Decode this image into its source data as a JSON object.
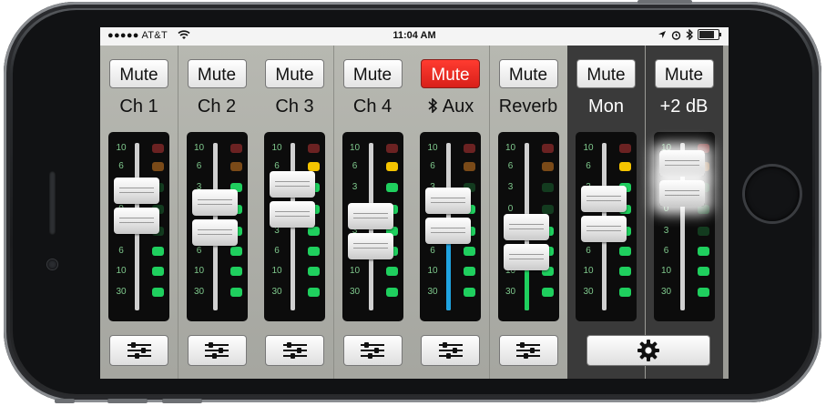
{
  "status_bar": {
    "carrier": "●●●●● AT&T",
    "time": "11:04 AM",
    "icons": [
      "signal-dots-icon",
      "wifi-icon",
      "location-arrow-icon",
      "alarm-clock-icon",
      "bluetooth-icon",
      "battery-icon"
    ]
  },
  "channels": [
    {
      "name": "Ch 1",
      "mute_label": "Mute",
      "muted": false,
      "fader_level": 0.62,
      "meter": [
        false,
        false,
        false,
        false,
        false,
        true,
        true,
        true
      ]
    },
    {
      "name": "Ch 2",
      "mute_label": "Mute",
      "muted": false,
      "fader_level": 0.55,
      "meter": [
        false,
        false,
        true,
        true,
        true,
        true,
        true,
        true
      ]
    },
    {
      "name": "Ch 3",
      "mute_label": "Mute",
      "muted": false,
      "fader_level": 0.66,
      "meter": [
        false,
        true,
        true,
        true,
        true,
        true,
        true,
        true
      ]
    },
    {
      "name": "Ch 4",
      "mute_label": "Mute",
      "muted": false,
      "fader_level": 0.47,
      "meter": [
        false,
        true,
        true,
        true,
        true,
        true,
        true,
        true
      ]
    },
    {
      "name": "Aux",
      "name_icon": "bluetooth-icon",
      "mute_label": "Mute",
      "muted": true,
      "fader_level": 0.56,
      "meter": [
        false,
        false,
        false,
        true,
        true,
        true,
        true,
        true
      ]
    },
    {
      "name": "Reverb",
      "mute_label": "Mute",
      "muted": false,
      "fader_level": 0.4,
      "meter": [
        false,
        false,
        false,
        false,
        true,
        true,
        true,
        true
      ]
    },
    {
      "name": "Mon",
      "mute_label": "Mute",
      "muted": false,
      "fader_level": 0.57,
      "meter": [
        false,
        true,
        true,
        true,
        true,
        true,
        true,
        true
      ]
    },
    {
      "name": "+2 dB",
      "mute_label": "Mute",
      "muted": false,
      "fader_level": 0.78,
      "meter": [
        false,
        false,
        false,
        false,
        false,
        true,
        true,
        true
      ]
    }
  ],
  "fader_scale": [
    "10",
    "6",
    "3",
    "0",
    "3",
    "6",
    "10",
    "30"
  ],
  "colors": {
    "led_green": "#1fcf5e",
    "led_yellow": "#f5c400",
    "led_red_off": "#6b2222",
    "led_orange_off": "#7a4a18",
    "aux_fill": "#1fa3e0",
    "reverb_fill": "#1fcf5e",
    "mute_active": "#e0241c"
  },
  "footer": {
    "eq_button_icon": "sliders-icon",
    "settings_button_icon": "gear-icon"
  }
}
